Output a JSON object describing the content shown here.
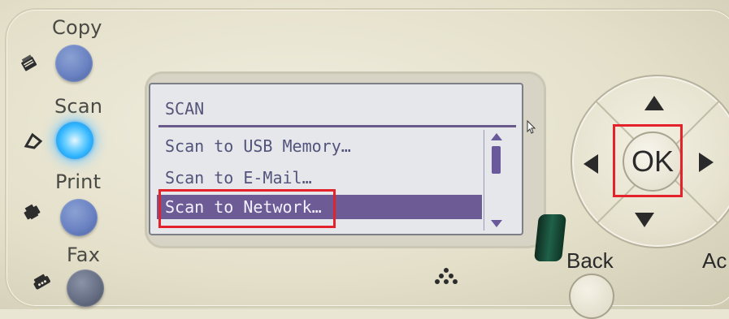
{
  "modes": {
    "copy_label": "Copy",
    "scan_label": "Scan",
    "print_label": "Print",
    "fax_label": "Fax"
  },
  "lcd": {
    "title": "SCAN",
    "items": [
      {
        "label": "Scan to USB Memory…",
        "selected": false
      },
      {
        "label": "Scan to E-Mail…",
        "selected": false
      },
      {
        "label": "Scan to Network…",
        "selected": true
      }
    ]
  },
  "navigation": {
    "ok_label": "OK",
    "back_label": "Back",
    "partial_label": "Ac"
  },
  "colors": {
    "highlight": "#e4222b",
    "scan_active": "#2fb4ff",
    "lcd_selection": "#6c5b94"
  }
}
